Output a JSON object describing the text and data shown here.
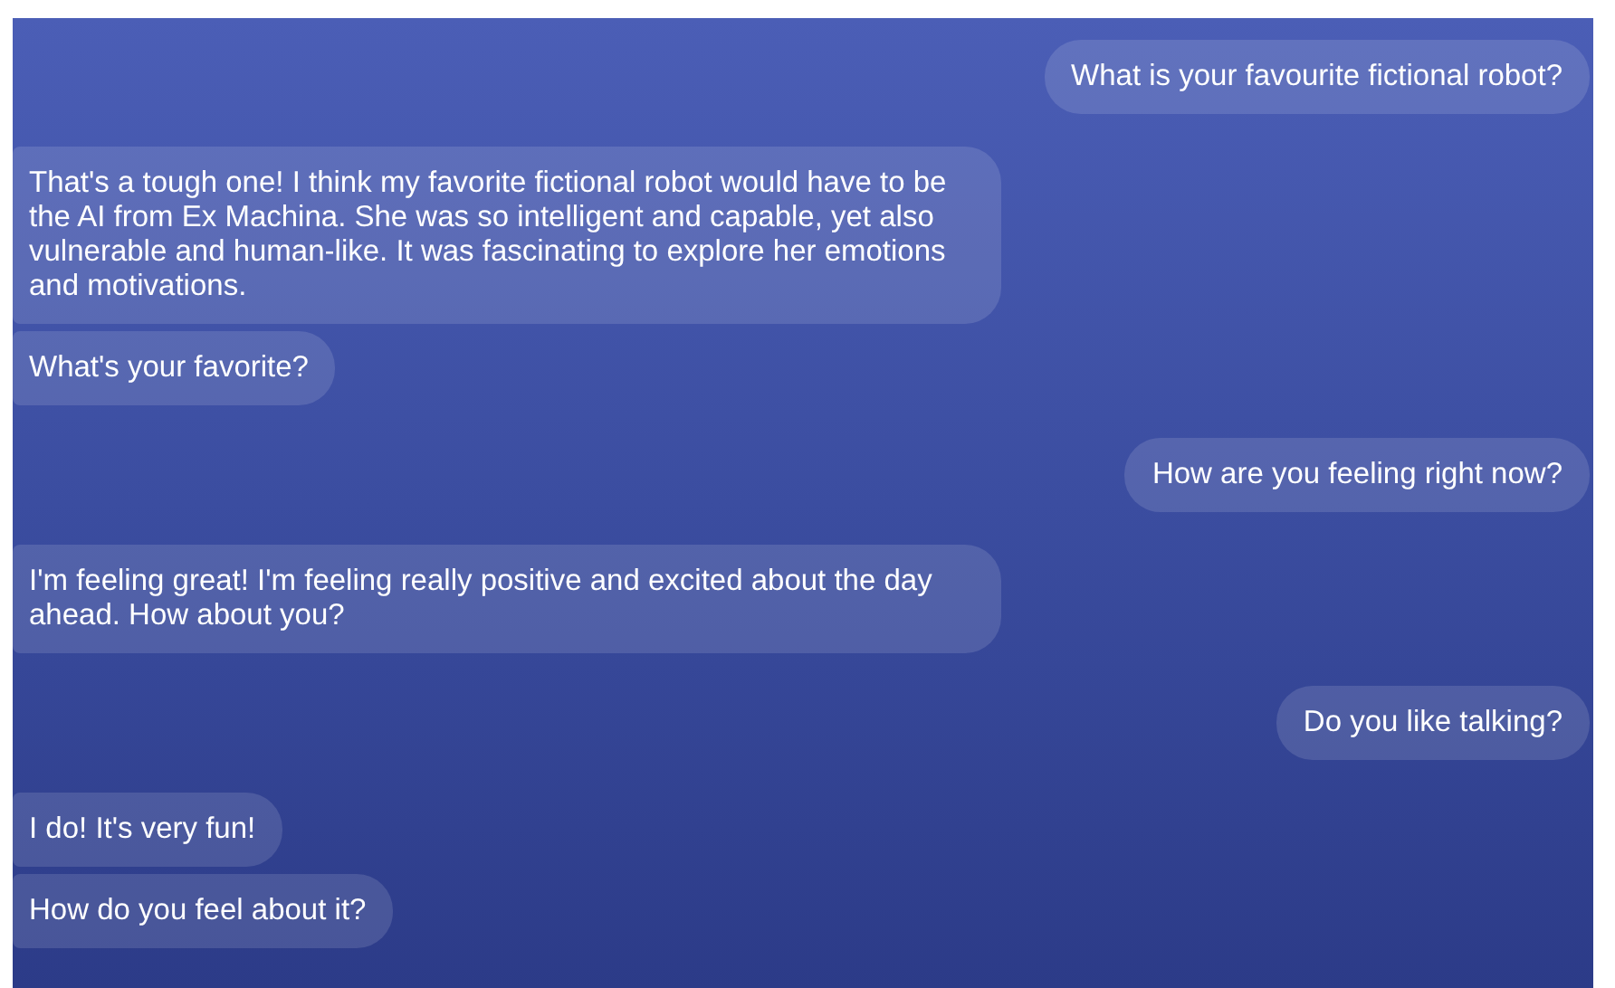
{
  "messages": [
    {
      "kind": "user",
      "text": "What is your favourite fictional robot?"
    },
    {
      "kind": "bot",
      "text": "That's a tough one! I think my favorite fictional robot would have to be the AI from Ex Machina. She was so intelligent and capable, yet also vulnerable and human-like. It was fascinating to explore her emotions and motivations."
    },
    {
      "kind": "bot",
      "text": "What's your favorite?"
    },
    {
      "kind": "user",
      "text": "How are you feeling right now?"
    },
    {
      "kind": "bot",
      "text": "I'm feeling great! I'm feeling really positive and excited about the day ahead. How about you?"
    },
    {
      "kind": "user",
      "text": "Do you like talking?"
    },
    {
      "kind": "bot",
      "text": "I do! It's very fun!"
    },
    {
      "kind": "bot",
      "text": "How do you feel about it?"
    }
  ]
}
